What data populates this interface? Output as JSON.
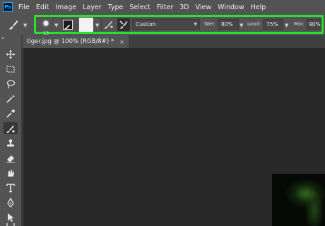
{
  "app": {
    "logo_text": "Ps"
  },
  "menu": [
    "File",
    "Edit",
    "Image",
    "Layer",
    "Type",
    "Select",
    "Filter",
    "3D",
    "View",
    "Window",
    "Help"
  ],
  "options": {
    "brush_size": "13",
    "mix_preset": "Custom",
    "wet_label": "Wet:",
    "wet_value": "80%",
    "load_label": "Load:",
    "load_value": "75%",
    "mix_label": "Mix:",
    "mix_value": "90%",
    "highlight_color": "#27e330"
  },
  "document_tab": {
    "title": "tiger.jpg @ 100% (RGB/8#) *",
    "close": "×"
  },
  "toolbar": {
    "collapse": "»",
    "tools": [
      "move-tool",
      "marquee-tool",
      "lasso-tool",
      "quick-select-tool",
      "eyedropper-tool",
      "mixer-brush-tool",
      "clone-stamp-tool",
      "eraser-tool",
      "smudge-tool",
      "type-tool",
      "pen-tool",
      "path-select-tool",
      "rectangle-tool"
    ],
    "active_tool": "mixer-brush-tool"
  }
}
